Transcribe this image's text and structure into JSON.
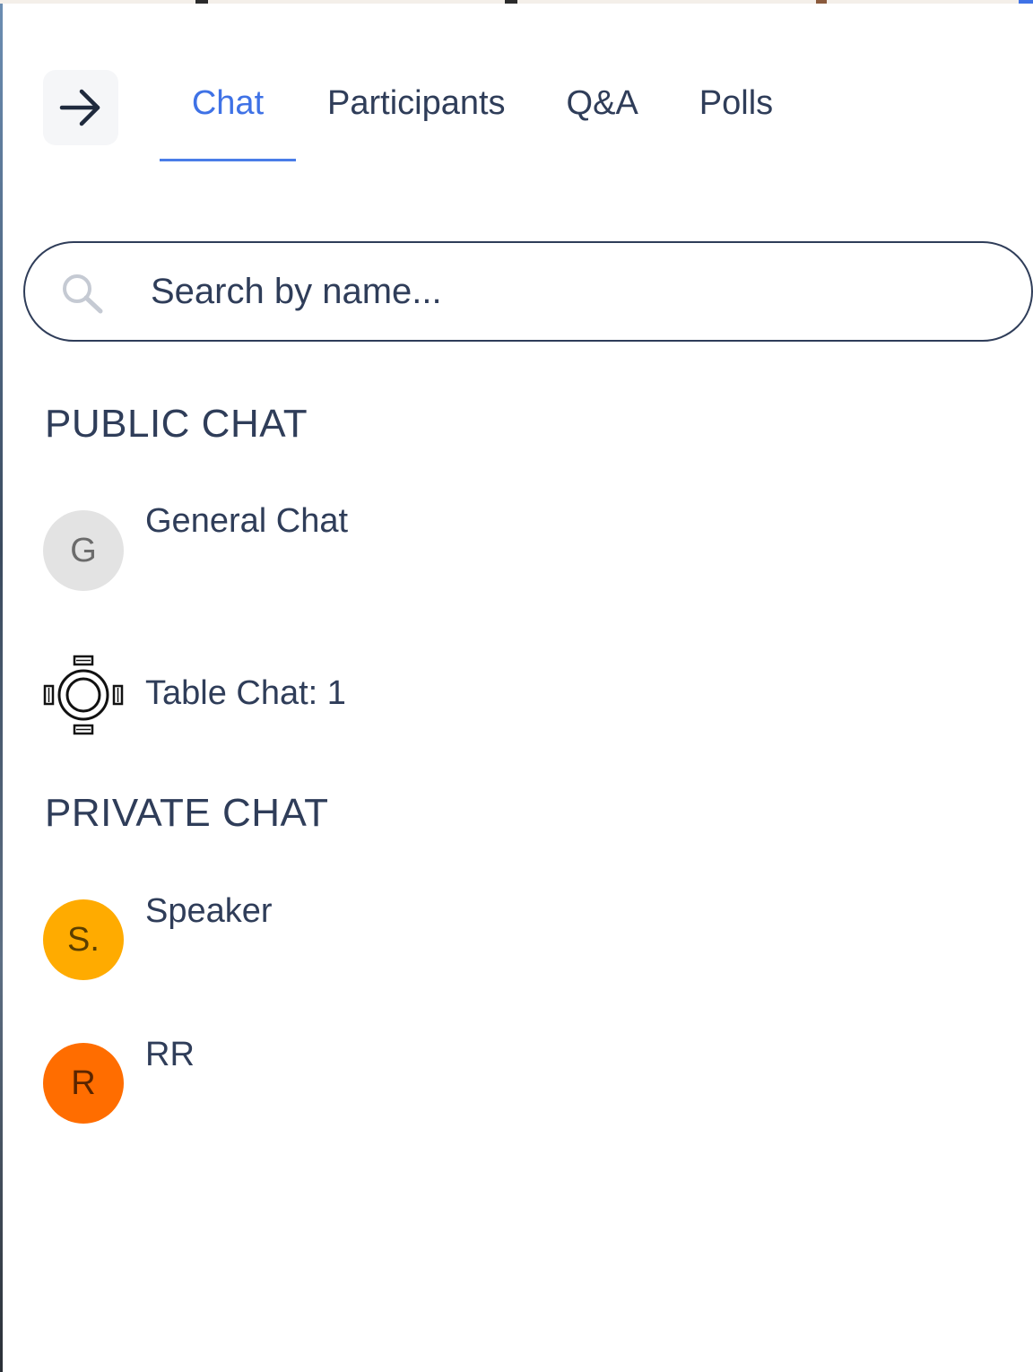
{
  "header": {
    "back_icon": "arrow-right-icon",
    "tabs": [
      {
        "label": "Chat",
        "active": true
      },
      {
        "label": "Participants",
        "active": false
      },
      {
        "label": "Q&A",
        "active": false
      },
      {
        "label": "Polls",
        "active": false
      }
    ]
  },
  "search": {
    "placeholder": "Search by name...",
    "value": "",
    "icon": "search-icon"
  },
  "public_chat": {
    "title": "PUBLIC CHAT",
    "items": [
      {
        "label": "General Chat",
        "avatar_letter": "G",
        "avatar_color": "#e3e3e3"
      },
      {
        "label": "Table Chat: 1",
        "icon": "round-table-icon"
      }
    ]
  },
  "private_chat": {
    "title": "PRIVATE CHAT",
    "items": [
      {
        "label": "Speaker",
        "avatar_letter": "S.",
        "avatar_color": "#ffab00"
      },
      {
        "label": "RR",
        "avatar_letter": "R",
        "avatar_color": "#ff6d00"
      }
    ]
  },
  "colors": {
    "accent": "#3f72e6",
    "text": "#2f3d59"
  }
}
